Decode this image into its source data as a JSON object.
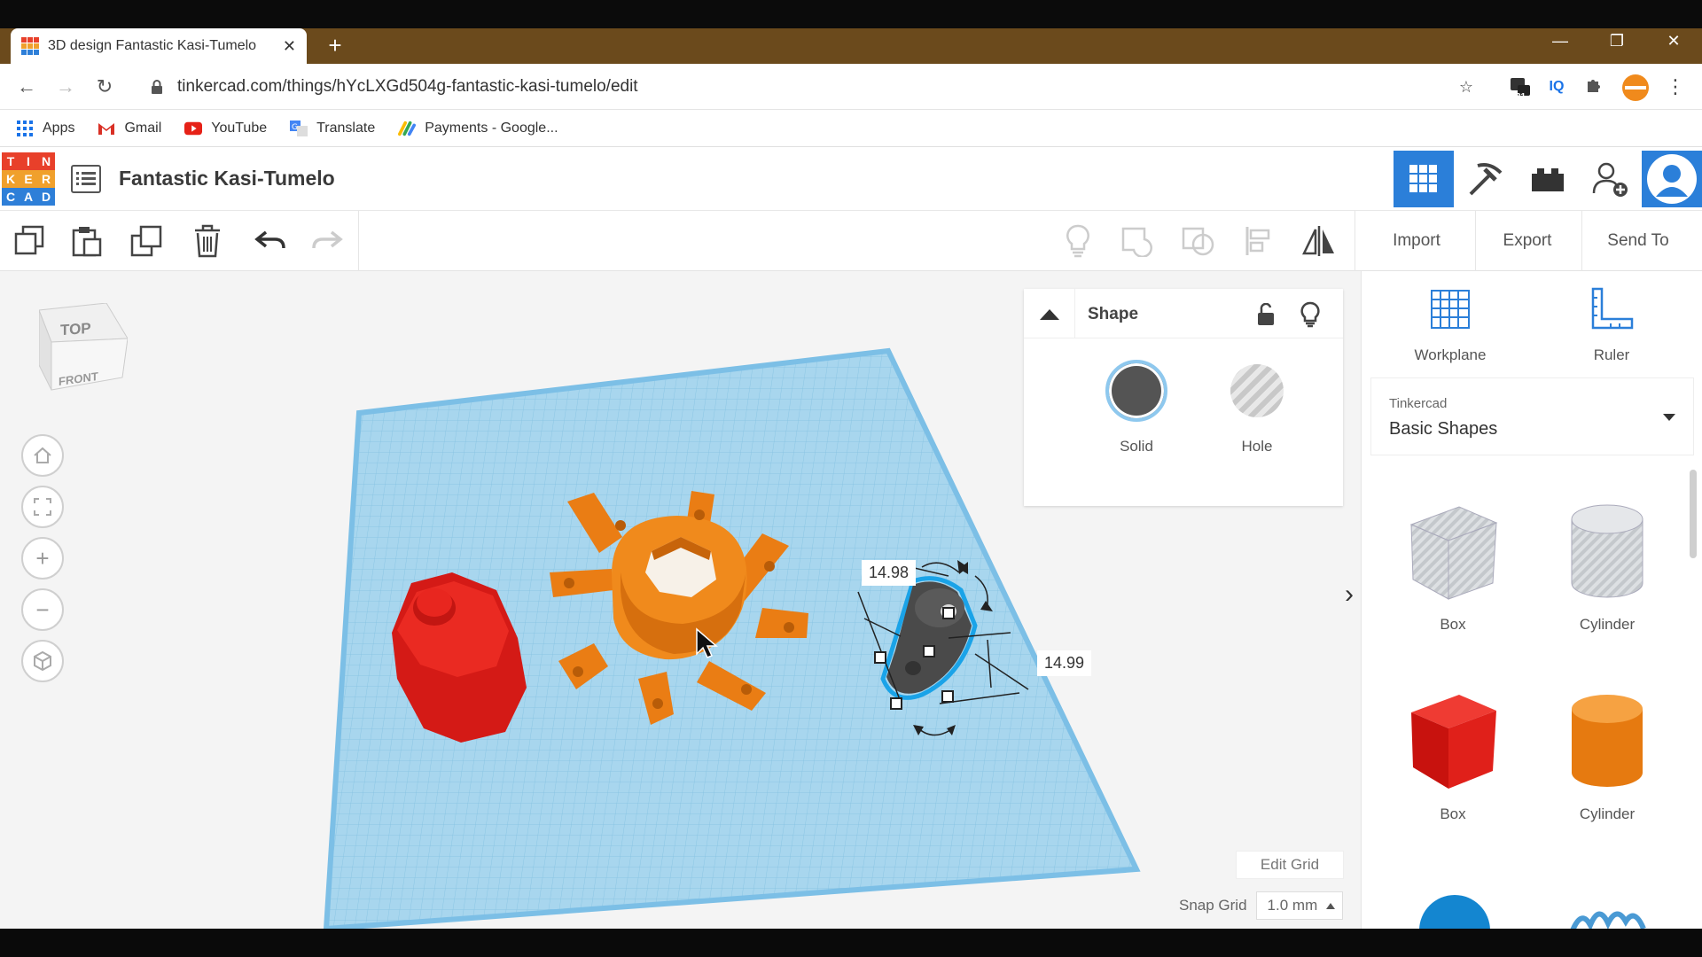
{
  "browser": {
    "tab_title": "3D design Fantastic Kasi-Tumelo",
    "url": "tinkercad.com/things/hYcLXGd504g-fantastic-kasi-tumelo/edit",
    "extension_badge": "21",
    "extension_iq": "IQ",
    "bookmarks": [
      "Apps",
      "Gmail",
      "YouTube",
      "Translate",
      "Payments - Google..."
    ]
  },
  "app": {
    "logo_letters": [
      "T",
      "I",
      "N",
      "K",
      "E",
      "R",
      "C",
      "A",
      "D"
    ],
    "logo_colors": [
      "#e8402a",
      "#e8402a",
      "#e8402a",
      "#f0a02c",
      "#f0a02c",
      "#f0a02c",
      "#2e7fd8",
      "#2e7fd8",
      "#2e7fd8"
    ],
    "design_title": "Fantastic Kasi-Tumelo"
  },
  "toolbar": {
    "import_label": "Import",
    "export_label": "Export",
    "send_to_label": "Send To"
  },
  "viewcube": {
    "top_label": "TOP",
    "front_label": "FRONT"
  },
  "shape_panel": {
    "title": "Shape",
    "solid_label": "Solid",
    "hole_label": "Hole"
  },
  "dimensions": {
    "width": "14.98",
    "depth": "14.99"
  },
  "grid": {
    "edit_grid_label": "Edit Grid",
    "snap_grid_label": "Snap Grid",
    "snap_grid_value": "1.0 mm"
  },
  "sidebar": {
    "workplane_label": "Workplane",
    "ruler_label": "Ruler",
    "library_source": "Tinkercad",
    "library_name": "Basic Shapes",
    "shapes": [
      {
        "label": "Box"
      },
      {
        "label": "Cylinder"
      },
      {
        "label": "Box"
      },
      {
        "label": "Cylinder"
      }
    ]
  },
  "colors": {
    "accent_blue": "#2b7fd9",
    "workplane_blue": "#a8d6ee",
    "red_shape": "#e2211c",
    "orange_shape": "#f08a1c",
    "dark_shape": "#4a4a4a"
  }
}
